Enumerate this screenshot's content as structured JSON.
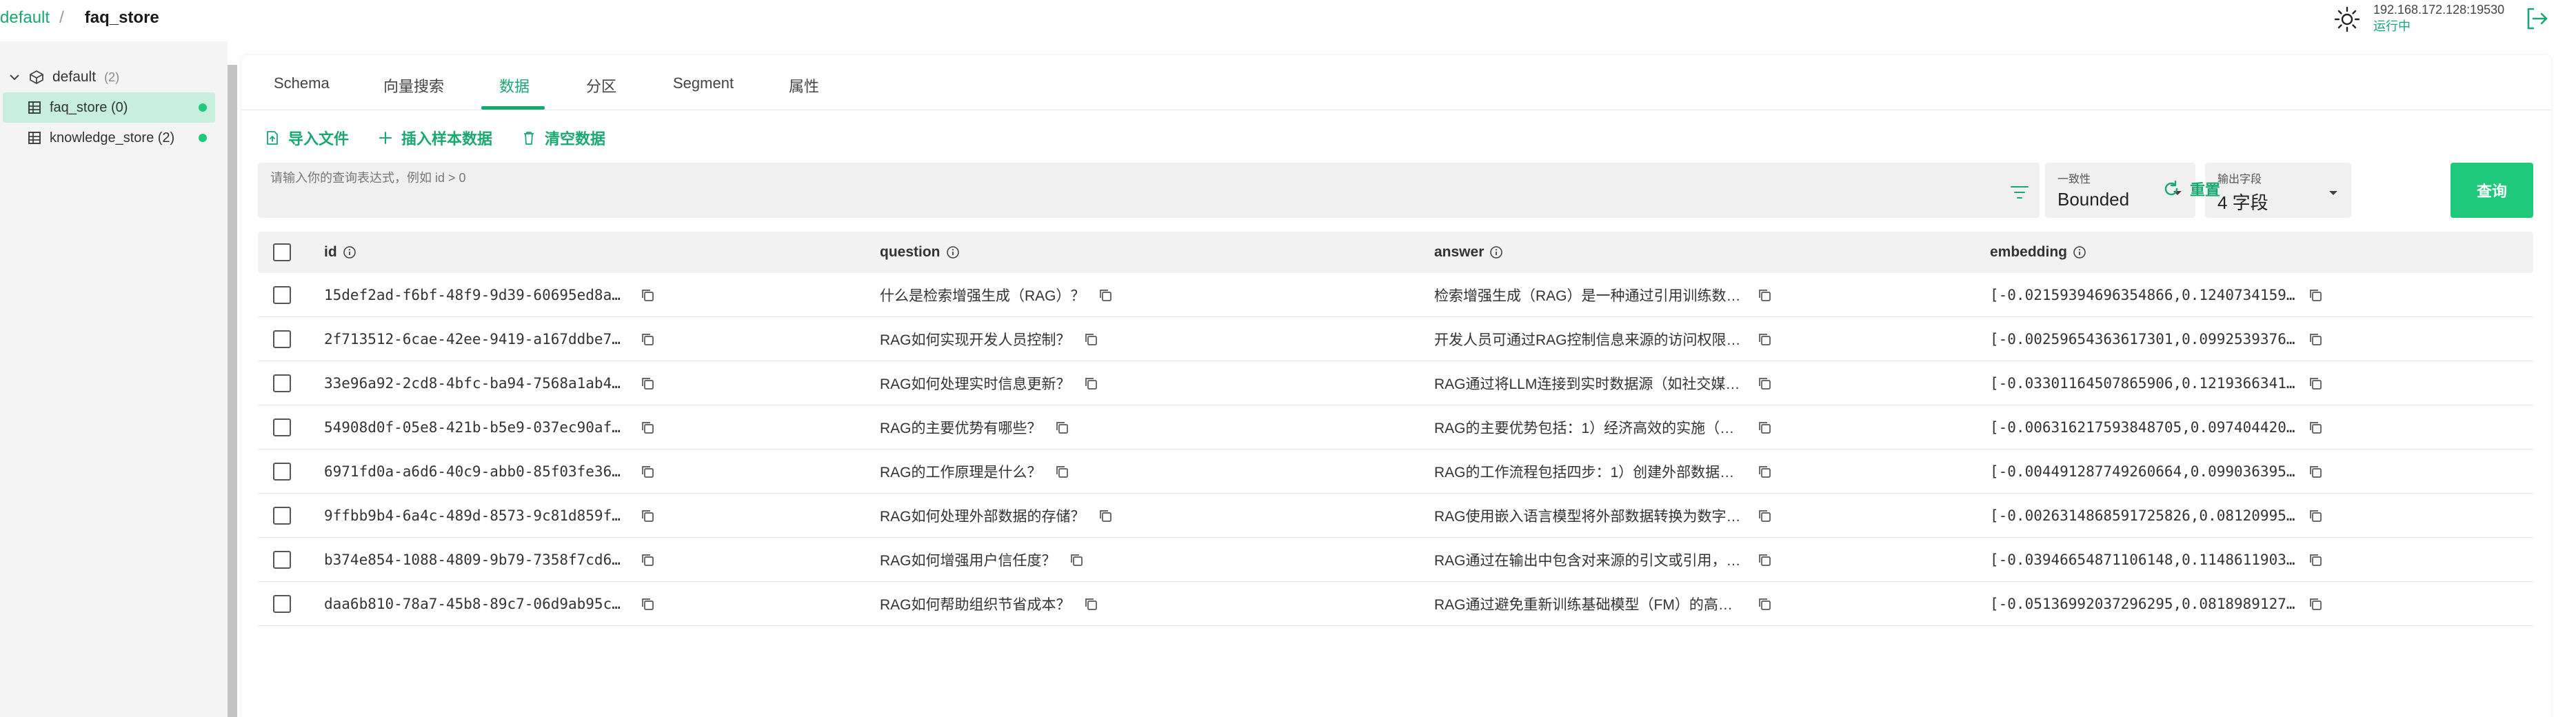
{
  "header": {
    "database": "default",
    "separator": "/",
    "collection": "faq_store",
    "server_address": "192.168.172.128:19530",
    "server_status": "运行中",
    "icons": [
      "sun-icon",
      "logout-icon"
    ]
  },
  "sidebar": {
    "root": {
      "label": "default",
      "count": "(2)"
    },
    "items": [
      {
        "label": "faq_store (0)",
        "active": true,
        "status_color": "#1ec97c"
      },
      {
        "label": "knowledge_store (2)",
        "active": false,
        "status_color": "#1ec97c"
      }
    ]
  },
  "tabs": [
    {
      "label": "Schema"
    },
    {
      "label": "向量搜索"
    },
    {
      "label": "数据",
      "active": true
    },
    {
      "label": "分区"
    },
    {
      "label": "Segment"
    },
    {
      "label": "属性"
    }
  ],
  "actions": {
    "import": "导入文件",
    "insert_sample": "插入样本数据",
    "clear": "清空数据"
  },
  "query": {
    "placeholder": "请输入你的查询表达式，例如 id > 0",
    "consistency_label": "一致性",
    "consistency_value": "Bounded",
    "output_label": "输出字段",
    "output_value": "4 字段",
    "reset": "重置",
    "submit": "查询"
  },
  "table": {
    "columns": [
      "id",
      "question",
      "answer",
      "embedding"
    ],
    "rows": [
      {
        "id": "15def2ad-f6bf-48f9-9d39-60695ed8ad…",
        "question": "什么是检索增强生成（RAG）？",
        "answer": "检索增强生成（RAG）是一种通过引用训练数据…",
        "embedding": "[-0.02159394696354866,0.1240734159…"
      },
      {
        "id": "2f713512-6cae-42ee-9419-a167ddbe7f…",
        "question": "RAG如何实现开发人员控制？",
        "answer": "开发人员可通过RAG控制信息来源的访问权限，…",
        "embedding": "[-0.00259654363617301,0.0992539376…"
      },
      {
        "id": "33e96a92-2cd8-4bfc-ba94-7568a1ab47…",
        "question": "RAG如何处理实时信息更新？",
        "answer": "RAG通过将LLM连接到实时数据源（如社交媒体…",
        "embedding": "[-0.03301164507865906,0.1219366341…"
      },
      {
        "id": "54908d0f-05e8-421b-b5e9-037ec90af3…",
        "question": "RAG的主要优势有哪些？",
        "answer": "RAG的主要优势包括：1）经济高效的实施（无…",
        "embedding": "[-0.006316217593848705,0.097404420…"
      },
      {
        "id": "6971fd0a-a6d6-40c9-abb0-85f03fe366…",
        "question": "RAG的工作原理是什么？",
        "answer": "RAG的工作流程包括四步：1）创建外部数据（…",
        "embedding": "[-0.004491287749260664,0.099036395…"
      },
      {
        "id": "9ffbb9b4-6a4c-489d-8573-9c81d859f4…",
        "question": "RAG如何处理外部数据的存储？",
        "answer": "RAG使用嵌入语言模型将外部数据转换为数字向…",
        "embedding": "[-0.0026314868591725826,0.08120995…"
      },
      {
        "id": "b374e854-1088-4809-9b79-7358f7cd69…",
        "question": "RAG如何增强用户信任度？",
        "answer": "RAG通过在输出中包含对来源的引文或引用，使…",
        "embedding": "[-0.03946654871106148,0.1148611903…"
      },
      {
        "id": "daa6b810-78a7-45b8-89c7-06d9ab95c5…",
        "question": "RAG如何帮助组织节省成本？",
        "answer": "RAG通过避免重新训练基础模型（FM）的高成…",
        "embedding": "[-0.05136992037296295,0.0818989127…"
      }
    ]
  },
  "colors": {
    "accent": "#1aa871",
    "button": "#1ec97c",
    "active_item": "#c8eedd"
  }
}
